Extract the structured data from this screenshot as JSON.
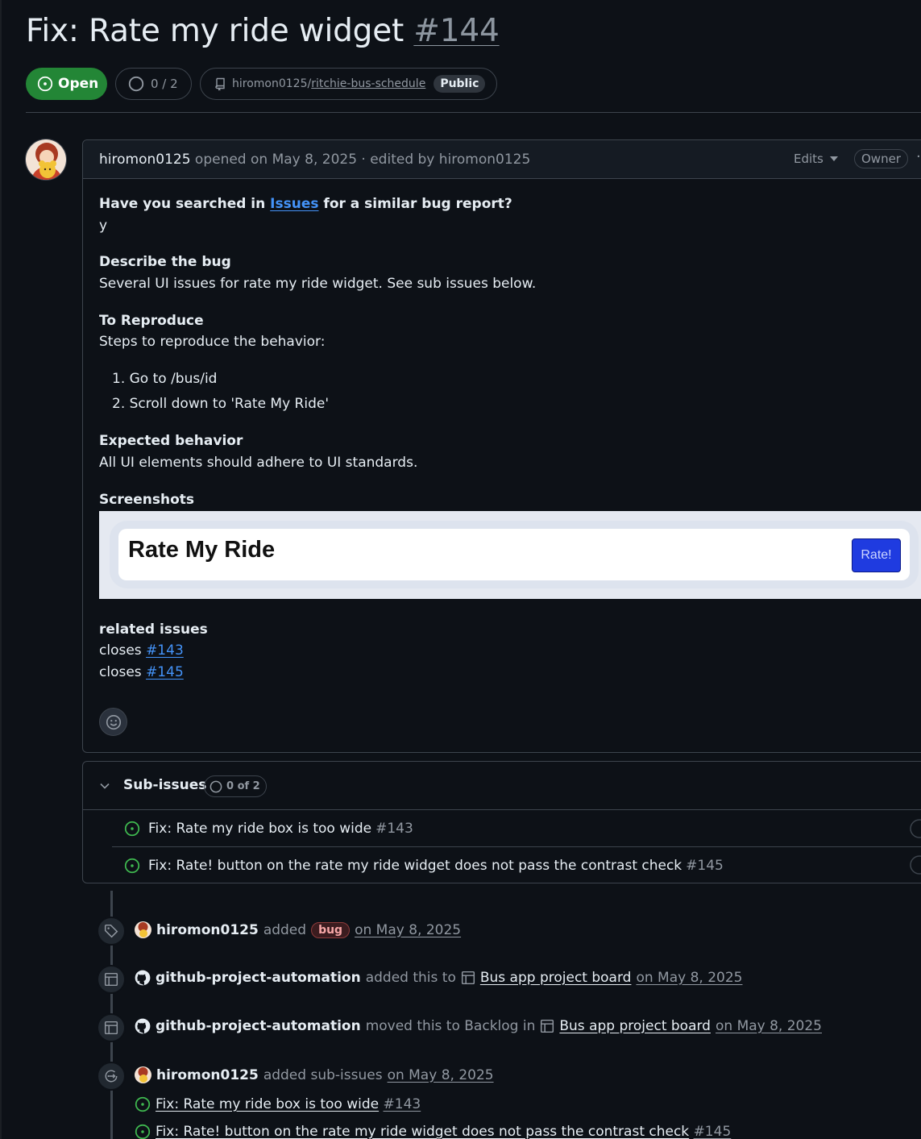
{
  "issue": {
    "title": "Fix: Rate my ride widget",
    "number": "#144",
    "state": "Open",
    "progress": "0 / 2",
    "repo_owner": "hiromon0125/",
    "repo_name": "ritchie-bus-schedule",
    "visibility": "Public"
  },
  "comment": {
    "author": "hiromon0125",
    "opened_text": "opened on May 8, 2025 · edited by hiromon0125",
    "edits_label": "Edits",
    "role": "Owner",
    "q_searched_pre": "Have you searched in ",
    "q_searched_link": "Issues",
    "q_searched_post": " for a similar bug report?",
    "a_searched": "y",
    "h_describe": "Describe the bug",
    "describe": "Several UI issues for rate my ride widget. See sub issues below.",
    "h_reproduce": "To Reproduce",
    "reproduce": "Steps to reproduce the behavior:",
    "steps": [
      "1. Go to /bus/id",
      "2. Scroll down to 'Rate My Ride'"
    ],
    "h_expected": "Expected behavior",
    "expected": "All UI elements should adhere to UI standards.",
    "h_screenshots": "Screenshots",
    "screenshot_title": "Rate My Ride",
    "screenshot_button": "Rate!",
    "h_related": "related issues",
    "closes_word": "closes",
    "closes": [
      "#143",
      "#145"
    ]
  },
  "sub_issues": {
    "label": "Sub-issues",
    "count": "0 of 2",
    "items": [
      {
        "title": "Fix: Rate my ride box is too wide",
        "number": "#143"
      },
      {
        "title": "Fix: Rate! button on the rate my ride widget does not pass the contrast check",
        "number": "#145"
      }
    ]
  },
  "timeline": {
    "e1": {
      "actor": "hiromon0125",
      "verb": "added",
      "label": "bug",
      "date": "on May 8, 2025"
    },
    "e2": {
      "actor": "github-project-automation",
      "verb": "added this to",
      "project": "Bus app project board",
      "date": "on May 8, 2025"
    },
    "e3": {
      "actor": "github-project-automation",
      "verb": "moved this to Backlog in",
      "project": "Bus app project board",
      "date": "on May 8, 2025"
    },
    "e4": {
      "actor": "hiromon0125",
      "verb": "added sub-issues",
      "date": "on May 8, 2025",
      "items": [
        {
          "title": "Fix: Rate my ride box is too wide",
          "number": "#143"
        },
        {
          "title": "Fix: Rate! button on the rate my ride widget does not pass the contrast check",
          "number": "#145"
        }
      ]
    }
  },
  "colors": {
    "open_green": "#238636",
    "link_blue": "#4493f8",
    "bg": "#0d1117",
    "border": "#3d444d"
  },
  "icons": [
    "issue-opened-icon",
    "issue-draft-icon",
    "repo-icon",
    "triangle-down-icon",
    "kebab-icon",
    "smiley-icon",
    "chevron-down-icon",
    "tag-icon",
    "table-icon",
    "github-mark-icon",
    "sub-issue-icon",
    "person-icon"
  ]
}
